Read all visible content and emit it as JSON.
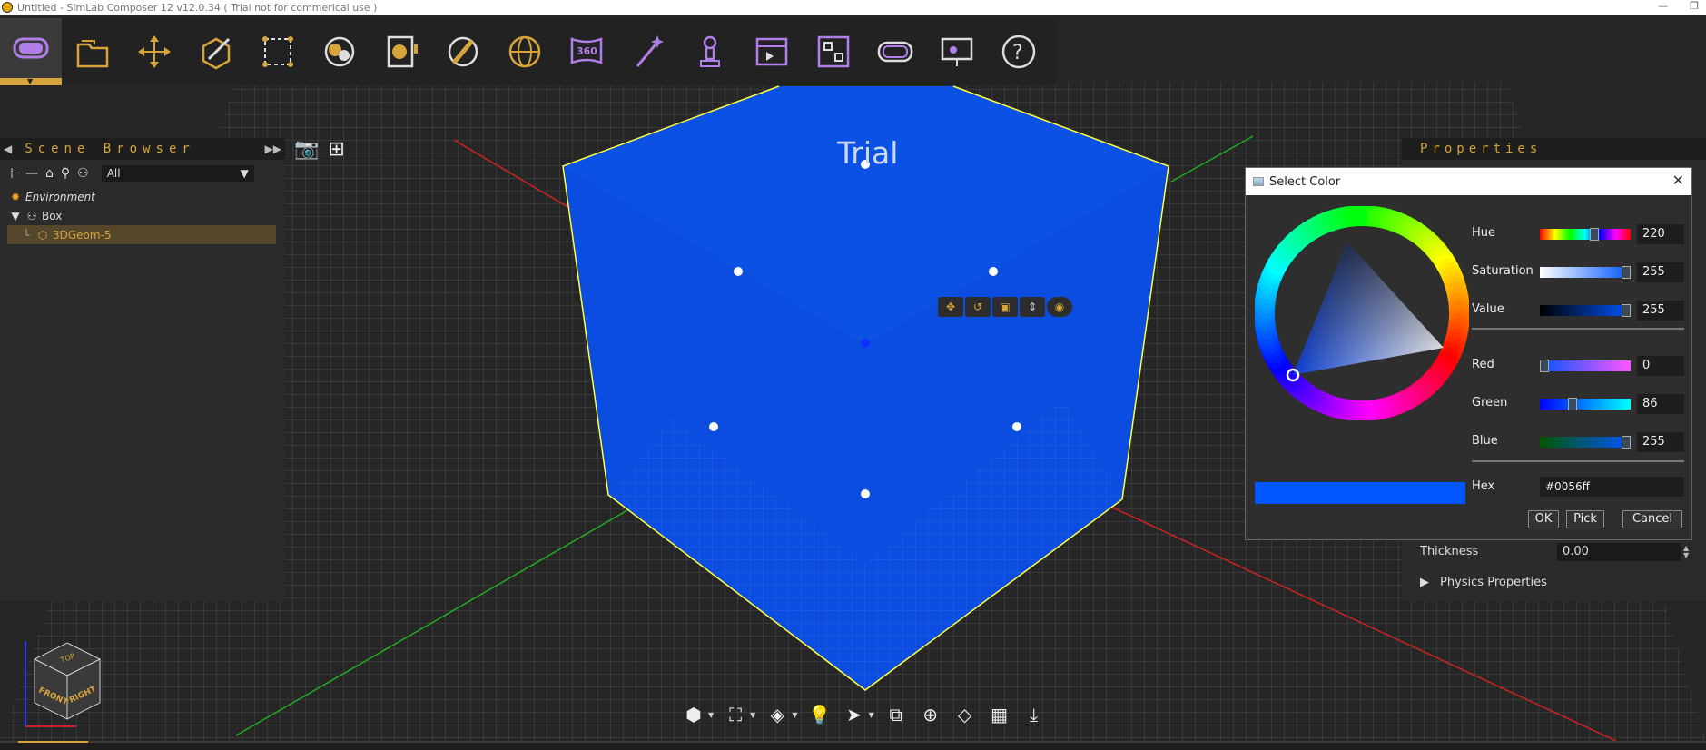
{
  "window": {
    "title": "Untitled - SimLab Composer 12 v12.0.34 ( Trial not for commerical use )",
    "minimize": "—",
    "restore": "❐"
  },
  "toolbar": {
    "tools": [
      {
        "name": "vr-headset-tool-icon",
        "active": true
      },
      {
        "name": "open-folder-tool-icon"
      },
      {
        "name": "move-tool-icon"
      },
      {
        "name": "edit-geometry-tool-icon"
      },
      {
        "name": "select-region-tool-icon"
      },
      {
        "name": "materials-tool-icon"
      },
      {
        "name": "render-tool-icon"
      },
      {
        "name": "lighting-tool-icon"
      },
      {
        "name": "environment-tool-icon"
      },
      {
        "name": "panorama-360-tool-icon",
        "label": "360"
      },
      {
        "name": "magic-wand-tool-icon"
      },
      {
        "name": "animation-tool-icon"
      },
      {
        "name": "sequence-tool-icon"
      },
      {
        "name": "scene-states-tool-icon"
      },
      {
        "name": "vr-viewer-tool-icon"
      },
      {
        "name": "presentation-tool-icon"
      },
      {
        "name": "help-tool-icon",
        "label": "?"
      }
    ],
    "accent": "#d6a43a",
    "purple": "#b07ee8"
  },
  "scene_browser": {
    "title": "Scene Browser",
    "filter": "All",
    "tree": [
      {
        "label": "Environment",
        "icon": "sun-icon",
        "italic": true
      },
      {
        "label": "Box",
        "icon": "hierarchy-icon",
        "expanded": true
      },
      {
        "label": "3DGeom-5",
        "icon": "mesh-icon",
        "selected": true
      }
    ]
  },
  "viewport": {
    "watermark": "Trial",
    "cube_color": "#0056ff",
    "selection_color": "#ffff40"
  },
  "properties": {
    "title": "Properties",
    "thickness_label": "Thickness",
    "thickness_value": "0.00",
    "physics_label": "Physics Properties"
  },
  "color_dialog": {
    "title": "Select Color",
    "close": "✕",
    "hue_label": "Hue",
    "hue_value": "220",
    "saturation_label": "Saturation",
    "saturation_value": "255",
    "value_label": "Value",
    "value_value": "255",
    "red_label": "Red",
    "red_value": "0",
    "green_label": "Green",
    "green_value": "86",
    "blue_label": "Blue",
    "blue_value": "255",
    "hex_label": "Hex",
    "hex_value": "#0056ff",
    "ok_label": "OK",
    "pick_label": "Pick",
    "cancel_label": "Cancel",
    "levels": {
      "hue": 0.61,
      "saturation": 1.0,
      "value": 1.0,
      "red": 0.0,
      "green": 0.34,
      "blue": 1.0
    }
  },
  "navcube": {
    "top": "TOP",
    "front": "FRONT",
    "right": "RIGHT"
  }
}
